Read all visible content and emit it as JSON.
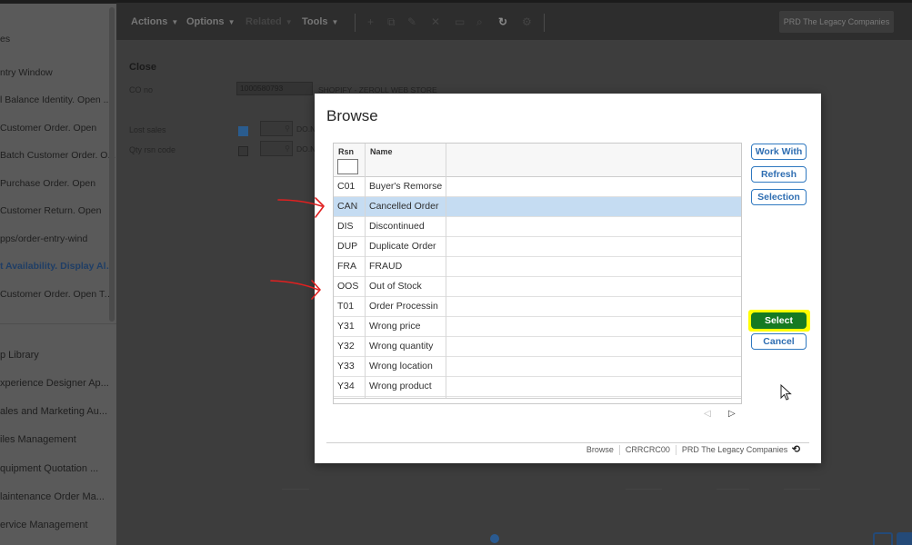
{
  "sidebar": {
    "items": [
      {
        "label": "es"
      },
      {
        "label": "ntry Window"
      },
      {
        "label": "l Balance Identity. Open ..."
      },
      {
        "label": "Customer Order. Open"
      },
      {
        "label": "Batch Customer Order. O..."
      },
      {
        "label": "Purchase Order. Open"
      },
      {
        "label": "Customer Return. Open"
      },
      {
        "label": "pps/order-entry-wind"
      },
      {
        "label": "t Availability. Display All ..."
      },
      {
        "label": "Customer Order. Open To..."
      },
      {
        "label": "p Library"
      },
      {
        "label": "xperience Designer Ap..."
      },
      {
        "label": "ales and Marketing Au..."
      },
      {
        "label": "iles Management"
      },
      {
        "label": "quipment Quotation ..."
      },
      {
        "label": "laintenance Order Ma..."
      },
      {
        "label": "ervice Management"
      }
    ]
  },
  "toolbar": {
    "actions": "Actions",
    "options": "Options",
    "related": "Related",
    "tools": "Tools",
    "company": "PRD The Legacy Companies"
  },
  "form": {
    "close_label": "Close",
    "co_no_label": "CO no",
    "co_no_value": "1000580793",
    "customer_name": "SHOPIFY - ZEROLL WEB STORE",
    "lost_sales_label": "Lost sales",
    "lost_sales_checked": true,
    "qty_rsn_label": "Qty rsn code",
    "qty_rsn_checked": false,
    "lost_sales_field": "DO.N",
    "qty_rsn_field": "DO.N"
  },
  "dialog": {
    "title": "Browse",
    "columns": {
      "rsn": "Rsn",
      "name": "Name"
    },
    "rows": [
      {
        "code": "C01",
        "name": "Buyer's Remorse"
      },
      {
        "code": "CAN",
        "name": "Cancelled Order"
      },
      {
        "code": "DIS",
        "name": "Discontinued"
      },
      {
        "code": "DUP",
        "name": "Duplicate Order"
      },
      {
        "code": "FRA",
        "name": "FRAUD"
      },
      {
        "code": "OOS",
        "name": "Out of Stock"
      },
      {
        "code": "T01",
        "name": "Order Processin"
      },
      {
        "code": "Y31",
        "name": "Wrong price"
      },
      {
        "code": "Y32",
        "name": "Wrong quantity"
      },
      {
        "code": "Y33",
        "name": "Wrong location"
      },
      {
        "code": "Y34",
        "name": "Wrong product"
      }
    ],
    "selected_code": "CAN",
    "buttons": {
      "work_with": "Work With",
      "refresh": "Refresh",
      "selection": "Selection",
      "select": "Select",
      "cancel": "Cancel"
    },
    "footer": {
      "panel": "Browse",
      "program": "CRRCRC00",
      "company": "PRD The Legacy Companies"
    }
  },
  "colors": {
    "selected_row": "#c5dcf2",
    "select_button": "#157a22",
    "highlight": "#ffff00",
    "annotation_arrow": "#e02020",
    "link_blue": "#2f6eb2"
  }
}
